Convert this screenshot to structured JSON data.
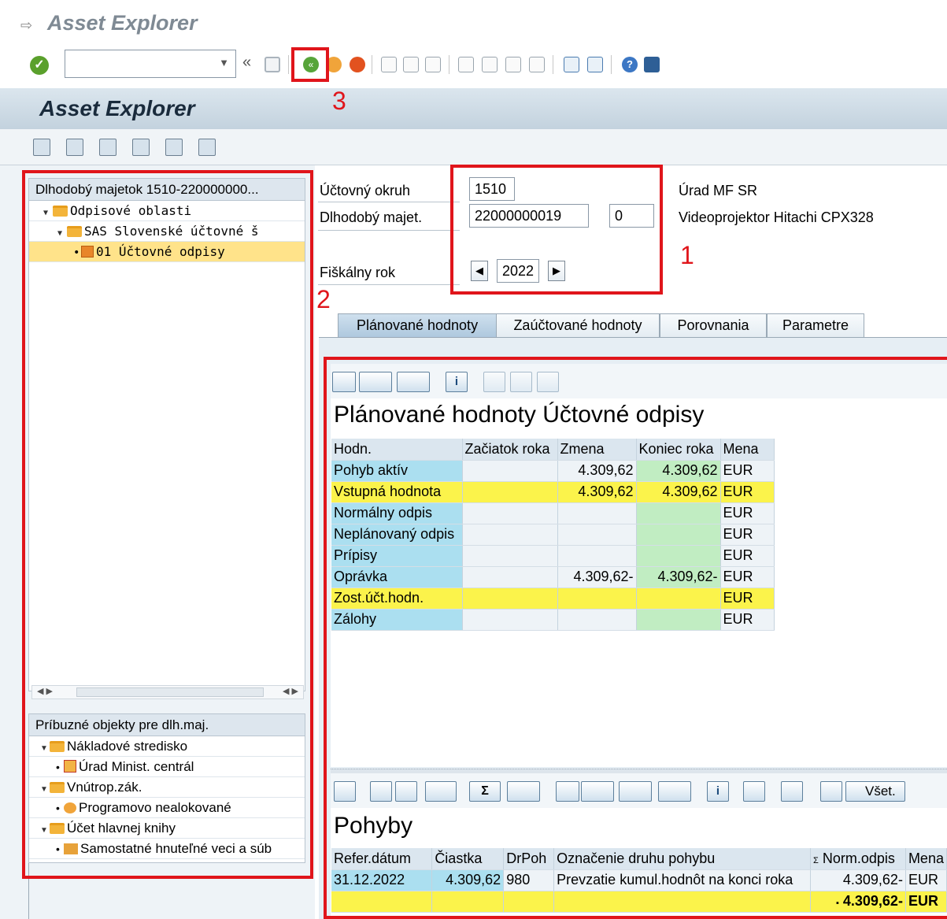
{
  "window": {
    "title": "Asset Explorer"
  },
  "system_toolbar": {
    "command_field_value": ""
  },
  "app": {
    "title": "Asset Explorer"
  },
  "left_tree": {
    "header": "Dlhodobý majetok 1510-220000000...",
    "nodes": [
      {
        "label": "Odpisové oblasti"
      },
      {
        "label": "SAS Slovenské účtovné š"
      },
      {
        "label": "01 Účtovné odpisy"
      }
    ]
  },
  "related_tree": {
    "header": "Príbuzné objekty pre dlh.maj.",
    "nodes": [
      {
        "label": "Nákladové stredisko"
      },
      {
        "label": "Úrad Minist. centrál"
      },
      {
        "label": "Vnútrop.zák."
      },
      {
        "label": "Programovo nealokované"
      },
      {
        "label": "Účet hlavnej knihy"
      },
      {
        "label": "Samostatné hnuteľné veci a súb"
      }
    ]
  },
  "form": {
    "company_code_label": "Účtovný okruh",
    "company_code_value": "1510",
    "company_code_desc": "Úrad MF SR",
    "asset_label": "Dlhodobý majet.",
    "asset_value": "22000000019",
    "asset_sub_value": "0",
    "asset_desc": "Videoprojektor Hitachi CPX328",
    "fiscal_year_label": "Fiškálny rok",
    "fiscal_year_value": "2022"
  },
  "tabs": [
    {
      "label": "Plánované hodnoty",
      "active": true
    },
    {
      "label": "Zaúčtované hodnoty",
      "active": false
    },
    {
      "label": "Porovnania",
      "active": false
    },
    {
      "label": "Parametre",
      "active": false
    }
  ],
  "planned": {
    "title": "Plánované hodnoty Účtovné odpisy",
    "columns": [
      "Hodn.",
      "Začiatok roka",
      "Zmena",
      "Koniec roka",
      "Mena"
    ],
    "rows": [
      {
        "name": "Pohyb aktív",
        "start": "",
        "change": "4.309,62",
        "end": "4.309,62",
        "cur": "EUR"
      },
      {
        "name": "Vstupná hodnota",
        "start": "",
        "change": "4.309,62",
        "end": "4.309,62",
        "cur": "EUR"
      },
      {
        "name": "Normálny odpis",
        "start": "",
        "change": "",
        "end": "",
        "cur": "EUR"
      },
      {
        "name": "Neplánovaný odpis",
        "start": "",
        "change": "",
        "end": "",
        "cur": "EUR"
      },
      {
        "name": "Prípisy",
        "start": "",
        "change": "",
        "end": "",
        "cur": "EUR"
      },
      {
        "name": "Oprávka",
        "start": "",
        "change": "4.309,62-",
        "end": "4.309,62-",
        "cur": "EUR"
      },
      {
        "name": "Zost.účt.hodn.",
        "start": "",
        "change": "",
        "end": "",
        "cur": "EUR"
      },
      {
        "name": "Zálohy",
        "start": "",
        "change": "",
        "end": "",
        "cur": "EUR"
      }
    ]
  },
  "movements": {
    "title": "Pohyby",
    "toolbar_all_label": "Všet.",
    "columns": [
      "Refer.dátum",
      "Čiastka",
      "DrPoh",
      "Označenie druhu pohybu",
      "Norm.odpis",
      "Mena"
    ],
    "sum_marker": "Σ",
    "rows": [
      {
        "date": "31.12.2022",
        "amount": "4.309,62",
        "type": "980",
        "desc": "Prevzatie kumul.hodnôt na konci roka",
        "norm": "4.309,62-",
        "cur": "EUR"
      }
    ],
    "total": {
      "marker": "▪",
      "norm": "4.309,62-",
      "cur": "EUR"
    }
  },
  "annotations": {
    "n1": "1",
    "n2": "2",
    "n3": "3"
  },
  "colors": {
    "annotation_red": "#e0151b",
    "key_cell": "#abdff0",
    "total_yellow": "#fbf34b",
    "end_green": "#c1edc2"
  }
}
